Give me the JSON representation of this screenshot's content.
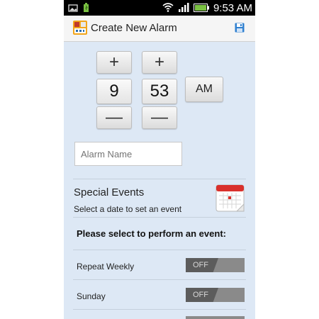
{
  "status": {
    "time": "9:53 AM"
  },
  "header": {
    "title": "Create New Alarm"
  },
  "time_picker": {
    "plus_label": "+",
    "minus_label": "—",
    "hour": "9",
    "minute": "53",
    "ampm": "AM"
  },
  "alarm_name": {
    "placeholder": "Alarm Name",
    "value": ""
  },
  "special_events": {
    "title": "Special Events",
    "subtitle": "Select a date to set an event"
  },
  "perform_label": "Please select to perform an event:",
  "options": [
    {
      "label": "Repeat Weekly",
      "state": "OFF"
    },
    {
      "label": "Sunday",
      "state": "OFF"
    }
  ],
  "colors": {
    "background": "#dde8f5",
    "toggle_dark": "#5c5c5c",
    "toggle_light": "#8a8a8a"
  }
}
